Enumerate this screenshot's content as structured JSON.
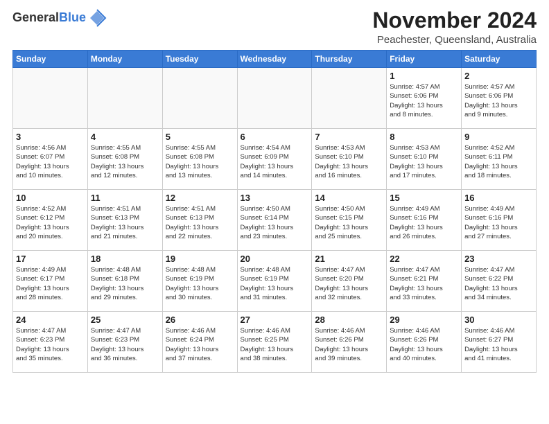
{
  "logo": {
    "general": "General",
    "blue": "Blue"
  },
  "header": {
    "month": "November 2024",
    "location": "Peachester, Queensland, Australia"
  },
  "weekdays": [
    "Sunday",
    "Monday",
    "Tuesday",
    "Wednesday",
    "Thursday",
    "Friday",
    "Saturday"
  ],
  "weeks": [
    [
      {
        "day": "",
        "info": ""
      },
      {
        "day": "",
        "info": ""
      },
      {
        "day": "",
        "info": ""
      },
      {
        "day": "",
        "info": ""
      },
      {
        "day": "",
        "info": ""
      },
      {
        "day": "1",
        "info": "Sunrise: 4:57 AM\nSunset: 6:06 PM\nDaylight: 13 hours\nand 8 minutes."
      },
      {
        "day": "2",
        "info": "Sunrise: 4:57 AM\nSunset: 6:06 PM\nDaylight: 13 hours\nand 9 minutes."
      }
    ],
    [
      {
        "day": "3",
        "info": "Sunrise: 4:56 AM\nSunset: 6:07 PM\nDaylight: 13 hours\nand 10 minutes."
      },
      {
        "day": "4",
        "info": "Sunrise: 4:55 AM\nSunset: 6:08 PM\nDaylight: 13 hours\nand 12 minutes."
      },
      {
        "day": "5",
        "info": "Sunrise: 4:55 AM\nSunset: 6:08 PM\nDaylight: 13 hours\nand 13 minutes."
      },
      {
        "day": "6",
        "info": "Sunrise: 4:54 AM\nSunset: 6:09 PM\nDaylight: 13 hours\nand 14 minutes."
      },
      {
        "day": "7",
        "info": "Sunrise: 4:53 AM\nSunset: 6:10 PM\nDaylight: 13 hours\nand 16 minutes."
      },
      {
        "day": "8",
        "info": "Sunrise: 4:53 AM\nSunset: 6:10 PM\nDaylight: 13 hours\nand 17 minutes."
      },
      {
        "day": "9",
        "info": "Sunrise: 4:52 AM\nSunset: 6:11 PM\nDaylight: 13 hours\nand 18 minutes."
      }
    ],
    [
      {
        "day": "10",
        "info": "Sunrise: 4:52 AM\nSunset: 6:12 PM\nDaylight: 13 hours\nand 20 minutes."
      },
      {
        "day": "11",
        "info": "Sunrise: 4:51 AM\nSunset: 6:13 PM\nDaylight: 13 hours\nand 21 minutes."
      },
      {
        "day": "12",
        "info": "Sunrise: 4:51 AM\nSunset: 6:13 PM\nDaylight: 13 hours\nand 22 minutes."
      },
      {
        "day": "13",
        "info": "Sunrise: 4:50 AM\nSunset: 6:14 PM\nDaylight: 13 hours\nand 23 minutes."
      },
      {
        "day": "14",
        "info": "Sunrise: 4:50 AM\nSunset: 6:15 PM\nDaylight: 13 hours\nand 25 minutes."
      },
      {
        "day": "15",
        "info": "Sunrise: 4:49 AM\nSunset: 6:16 PM\nDaylight: 13 hours\nand 26 minutes."
      },
      {
        "day": "16",
        "info": "Sunrise: 4:49 AM\nSunset: 6:16 PM\nDaylight: 13 hours\nand 27 minutes."
      }
    ],
    [
      {
        "day": "17",
        "info": "Sunrise: 4:49 AM\nSunset: 6:17 PM\nDaylight: 13 hours\nand 28 minutes."
      },
      {
        "day": "18",
        "info": "Sunrise: 4:48 AM\nSunset: 6:18 PM\nDaylight: 13 hours\nand 29 minutes."
      },
      {
        "day": "19",
        "info": "Sunrise: 4:48 AM\nSunset: 6:19 PM\nDaylight: 13 hours\nand 30 minutes."
      },
      {
        "day": "20",
        "info": "Sunrise: 4:48 AM\nSunset: 6:19 PM\nDaylight: 13 hours\nand 31 minutes."
      },
      {
        "day": "21",
        "info": "Sunrise: 4:47 AM\nSunset: 6:20 PM\nDaylight: 13 hours\nand 32 minutes."
      },
      {
        "day": "22",
        "info": "Sunrise: 4:47 AM\nSunset: 6:21 PM\nDaylight: 13 hours\nand 33 minutes."
      },
      {
        "day": "23",
        "info": "Sunrise: 4:47 AM\nSunset: 6:22 PM\nDaylight: 13 hours\nand 34 minutes."
      }
    ],
    [
      {
        "day": "24",
        "info": "Sunrise: 4:47 AM\nSunset: 6:23 PM\nDaylight: 13 hours\nand 35 minutes."
      },
      {
        "day": "25",
        "info": "Sunrise: 4:47 AM\nSunset: 6:23 PM\nDaylight: 13 hours\nand 36 minutes."
      },
      {
        "day": "26",
        "info": "Sunrise: 4:46 AM\nSunset: 6:24 PM\nDaylight: 13 hours\nand 37 minutes."
      },
      {
        "day": "27",
        "info": "Sunrise: 4:46 AM\nSunset: 6:25 PM\nDaylight: 13 hours\nand 38 minutes."
      },
      {
        "day": "28",
        "info": "Sunrise: 4:46 AM\nSunset: 6:26 PM\nDaylight: 13 hours\nand 39 minutes."
      },
      {
        "day": "29",
        "info": "Sunrise: 4:46 AM\nSunset: 6:26 PM\nDaylight: 13 hours\nand 40 minutes."
      },
      {
        "day": "30",
        "info": "Sunrise: 4:46 AM\nSunset: 6:27 PM\nDaylight: 13 hours\nand 41 minutes."
      }
    ]
  ]
}
